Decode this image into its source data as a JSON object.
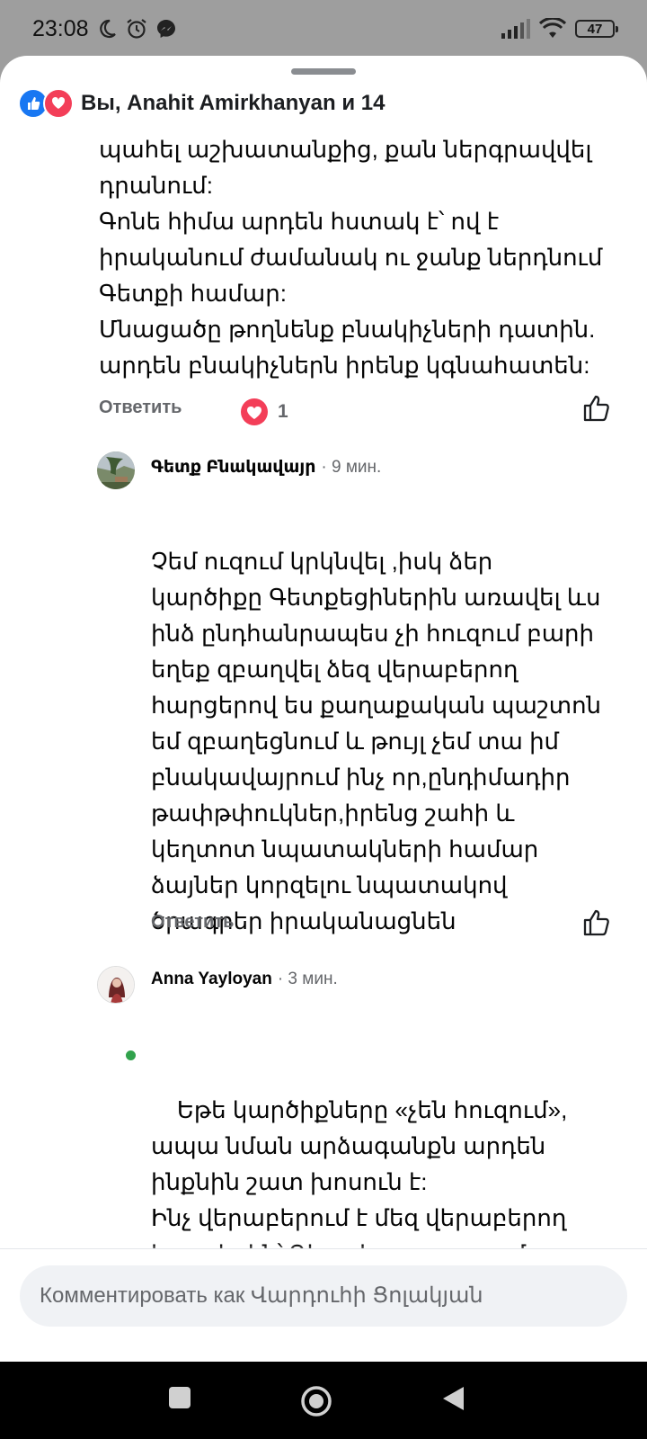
{
  "status_bar": {
    "time": "23:08",
    "battery": "47",
    "icons": [
      "moon-icon",
      "alarm-icon",
      "messenger-icon",
      "signal-icon",
      "wifi-icon",
      "battery-icon"
    ]
  },
  "reactions_summary": {
    "icons": [
      "like-icon",
      "love-icon"
    ],
    "text": "Вы, Anahit Amirkhanyan и 14"
  },
  "comments": [
    {
      "text": "պահել աշխատանքից, քան ներգրավվել\nդրանում:\nԳոնե հիմա արդեն հստակ է՝ ով է\nիրականում ժամանակ ու ջանք ներդնում\nԳետքի համար:\nՄնացածը թողնենք բնակիչների դատին.\nարդեն բնակիչներն իրենք կգնահատեն:",
      "reply_label": "Ответить",
      "reaction_count": "1"
    },
    {
      "author": "Գետք Բնակավայր",
      "time": "· 9 мин.",
      "text": "Չեմ ուզում կրկնվել ,իսկ ձեր\nկարծիքը Գետքեցիներին առավել ևս\nինձ ընդհանրապես չի հուզում բարի\nեղեք զբաղվել ձեզ վերաբերող\nհարցերով ես քաղաքական պաշտոն\nեմ զբաղեցնում և թույլ չեմ տա իմ\nբնակավայրում ինչ որ,ընդիմադիր\nթափթփուկներ,իրենց շահի և\nկեղտոտ նպատակների համար\nձայներ կորզելու նպատակով\nծրագրեր իրականացնեն",
      "reply_label": "Ответить"
    },
    {
      "author": "Anna Yayloyan",
      "time": "· 3 мин.",
      "text": "Եթե կարծիքները «չեն հուզում»,\nապա նման արձագանքն արդեն\nինքնին շատ խոսուն է:\nԻնչ վերաբերում է մեզ վերաբերող\nհարցերին՝ Գետքի զարգացումը,\nվստահ եղեք, հենց դրանցից մեկն է:",
      "emoji": "😉"
    }
  ],
  "composer": {
    "placeholder": "Комментировать как Վարդուհի Ցոլակյան"
  },
  "nav_bar": {
    "buttons": [
      "recents-icon",
      "home-icon",
      "back-icon"
    ]
  }
}
